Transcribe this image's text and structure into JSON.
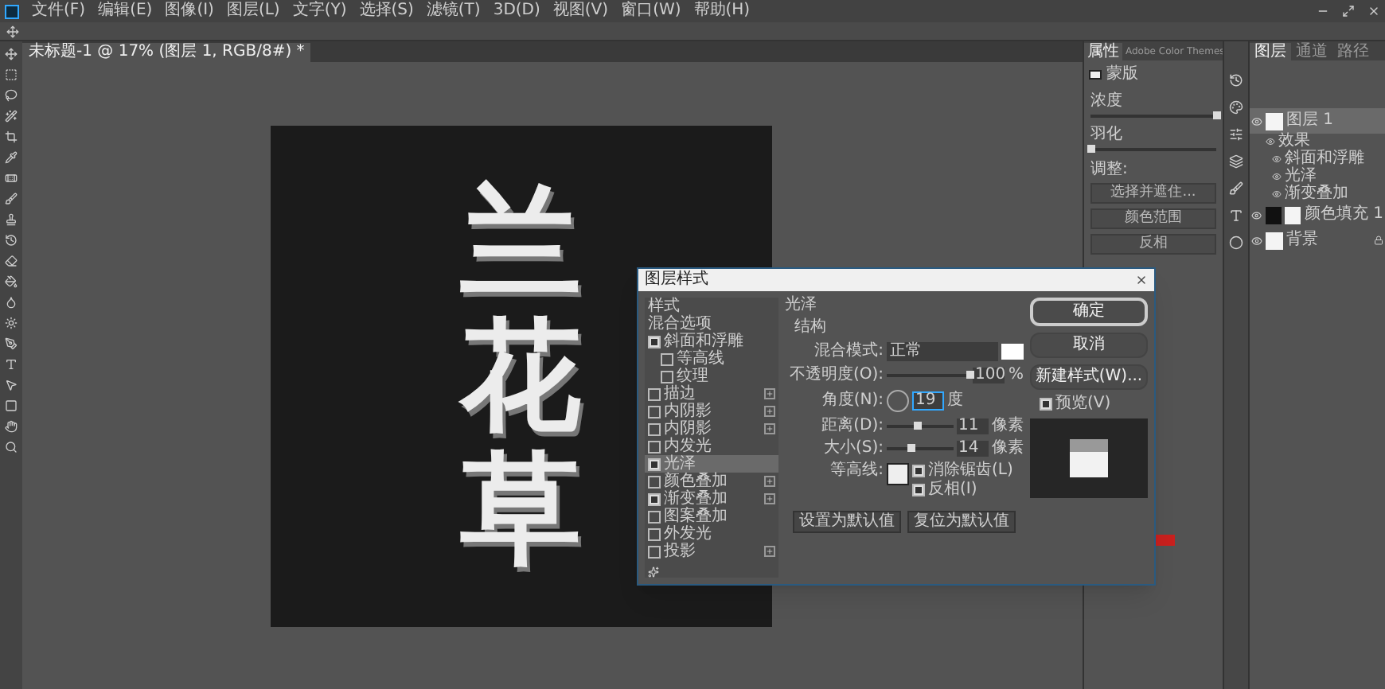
{
  "menu": [
    "文件(F)",
    "编辑(E)",
    "图像(I)",
    "图层(L)",
    "文字(Y)",
    "选择(S)",
    "滤镜(T)",
    "3D(D)",
    "视图(V)",
    "窗口(W)",
    "帮助(H)"
  ],
  "document_tab": {
    "label": "未标题-1 @ 17% (图层 1, RGB/8#) *",
    "selected": true
  },
  "canvas": {
    "artwork_text": [
      "兰",
      "花",
      "草"
    ]
  },
  "dialog": {
    "title": "图层样式",
    "styles": [
      {
        "label": "样式",
        "kind": "header",
        "selected": false
      },
      {
        "label": "混合选项",
        "kind": "header",
        "selected": false
      },
      {
        "label": "斜面和浮雕",
        "kind": "effect",
        "checked": true,
        "selected": false,
        "addable": false
      },
      {
        "label": "等高线",
        "kind": "sub",
        "checked": false,
        "selected": false
      },
      {
        "label": "纹理",
        "kind": "sub",
        "checked": false,
        "selected": false
      },
      {
        "label": "描边",
        "kind": "effect",
        "checked": false,
        "selected": false,
        "addable": true
      },
      {
        "label": "内阴影",
        "kind": "effect",
        "checked": false,
        "selected": false,
        "addable": true
      },
      {
        "label": "内阴影",
        "kind": "effect",
        "checked": false,
        "selected": false,
        "addable": true
      },
      {
        "label": "内发光",
        "kind": "effect",
        "checked": false,
        "selected": false,
        "addable": false
      },
      {
        "label": "光泽",
        "kind": "effect",
        "checked": true,
        "selected": true,
        "addable": false
      },
      {
        "label": "颜色叠加",
        "kind": "effect",
        "checked": false,
        "selected": false,
        "addable": true
      },
      {
        "label": "渐变叠加",
        "kind": "effect",
        "checked": true,
        "selected": false,
        "addable": true
      },
      {
        "label": "图案叠加",
        "kind": "effect",
        "checked": false,
        "selected": false,
        "addable": false
      },
      {
        "label": "外发光",
        "kind": "effect",
        "checked": false,
        "selected": false,
        "addable": false
      },
      {
        "label": "投影",
        "kind": "effect",
        "checked": false,
        "selected": false,
        "addable": true
      }
    ],
    "section_title": "光泽",
    "group_title": "结构",
    "fields": [
      {
        "kind": "blend",
        "label": "混合模式:",
        "value": "正常"
      },
      {
        "kind": "slider",
        "label": "不透明度(O):",
        "value": "100",
        "unit": "%",
        "level": 1.0
      },
      {
        "kind": "angle",
        "label": "角度(N):",
        "value": "19",
        "unit": "度"
      },
      {
        "kind": "slider",
        "label": "距离(D):",
        "value": "11",
        "unit": "像素",
        "level": 0.45
      },
      {
        "kind": "slider",
        "label": "大小(S):",
        "value": "14",
        "unit": "像素",
        "level": 0.35
      },
      {
        "kind": "contour",
        "label": "等高线:",
        "options": [
          {
            "label": "消除锯齿(L)",
            "checked": true
          },
          {
            "label": "反相(I)",
            "checked": true
          }
        ]
      }
    ],
    "default_buttons": [
      "设置为默认值",
      "复位为默认值"
    ],
    "actions": [
      {
        "label": "确定",
        "primary": true
      },
      {
        "label": "取消",
        "primary": false
      },
      {
        "label": "新建样式(W)...",
        "primary": false
      }
    ],
    "preview": {
      "label": "预览(V)",
      "checked": true
    }
  },
  "properties": {
    "tabs": [
      {
        "label": "属性",
        "selected": true
      },
      {
        "label": "Adobe Color Themes",
        "selected": false
      }
    ],
    "section": "蒙版",
    "sliders": [
      {
        "label": "浓度",
        "level": 1.0
      },
      {
        "label": "羽化",
        "level": 0.0
      }
    ],
    "adjust_label": "调整:",
    "buttons": [
      "选择并遮住...",
      "颜色范围",
      "反相"
    ]
  },
  "layers": {
    "tabs": [
      {
        "label": "图层",
        "selected": true
      },
      {
        "label": "通道",
        "selected": false
      },
      {
        "label": "路径",
        "selected": false
      }
    ],
    "items": [
      {
        "name": "图层 1",
        "kind": "layer",
        "selected": true,
        "visible": true,
        "effects_label": "效果",
        "effects": [
          "斜面和浮雕",
          "光泽",
          "渐变叠加"
        ]
      },
      {
        "name": "颜色填充 1",
        "kind": "fill",
        "selected": false,
        "visible": true
      },
      {
        "name": "背景",
        "kind": "background",
        "selected": false,
        "visible": true
      }
    ]
  }
}
